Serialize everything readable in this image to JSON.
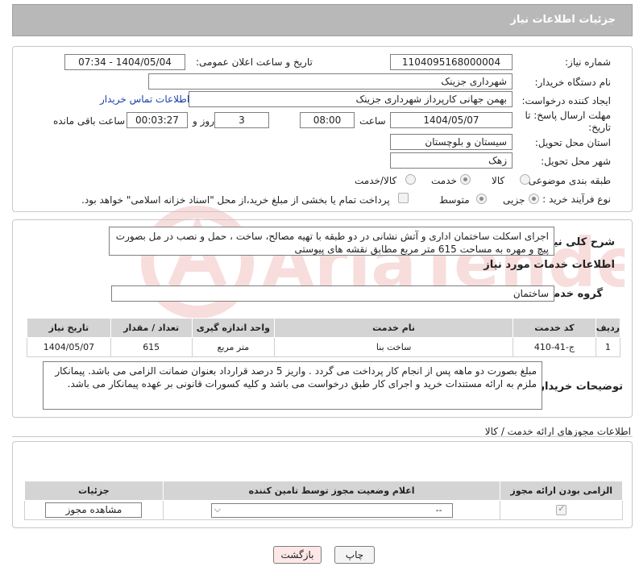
{
  "header": {
    "title": "جزئیات اطلاعات نیاز"
  },
  "form": {
    "need_number_label": "شماره نیاز:",
    "need_number": "1104095168000004",
    "announce_label": "تاریخ و ساعت اعلان عمومی:",
    "announce_value": "1404/05/04 - 07:34",
    "buyer_org_label": "نام دستگاه خریدار:",
    "buyer_org": "شهرداری جزینک",
    "creator_label": "ایجاد کننده درخواست:",
    "creator": "بهمن جهانی کارپرداز شهرداری جزینک",
    "contact_link": "اطلاعات تماس خریدار",
    "deadline_label": "مهلت ارسال پاسخ: تا تاریخ:",
    "deadline_date": "1404/05/07",
    "time_label": "ساعت",
    "deadline_time": "08:00",
    "days_value": "3",
    "days_label": "روز و",
    "remaining_time": "00:03:27",
    "remaining_label": "ساعت باقی مانده",
    "province_label": "استان محل تحویل:",
    "province": "سیستان و بلوچستان",
    "city_label": "شهر محل تحویل:",
    "city": "زهک",
    "category_label": "طبقه بندی موضوعی:",
    "category_options": [
      "کالا",
      "خدمت",
      "کالا/خدمت"
    ],
    "category_selected": "خدمت",
    "process_label": "نوع فرآیند خرید :",
    "process_options": [
      "جزیی",
      "متوسط"
    ],
    "process_selected": "جزیی",
    "payment_note": "پرداخت تمام یا بخشی از مبلغ خرید،از محل \"اسناد خزانه اسلامی\" خواهد بود."
  },
  "description": {
    "label": "شرح کلی نیاز:",
    "text": "اجرای اسکلت ساختمان اداری و آتش نشانی در دو طبقه با تهیه مصالح، ساخت ، حمل و نصب در مل بصورت پیچ و مهره به مساحت 615 متر مربع مطابق نقشه های پیوستی"
  },
  "services": {
    "section_title": "اطلاعات خدمات مورد نیاز",
    "group_label": "گروه خدمت:",
    "group_value": "ساختمان",
    "columns": [
      "ردیف",
      "کد خدمت",
      "نام خدمت",
      "واحد اندازه گیری",
      "تعداد / مقدار",
      "تاریخ نیاز"
    ],
    "rows": [
      {
        "row": "1",
        "code": "ج-41-410",
        "name": "ساخت بنا",
        "unit": "متر مربع",
        "qty": "615",
        "date": "1404/05/07"
      }
    ]
  },
  "buyer_notes": {
    "label": "توضیحات خریدار:",
    "text": "مبلغ بصورت دو ماهه پس از انجام کار پرداخت می گردد . واریز 5 درصد قرارداد بعنوان ضمانت الزامی می باشد. پیمانکار ملزم به ارائه مستندات خرید و اجرای کار طبق درخواست می باشد و کلیه کسورات قانونی بر عهده پیمانکار می باشد."
  },
  "permits": {
    "section_title": "اطلاعات مجوزهای ارائه خدمت / کالا",
    "columns": [
      "الزامی بودن ارائه مجوز",
      "اعلام وضعیت مجوز توسط تامین کننده",
      "جزئیات"
    ],
    "select_value": "--",
    "view_button": "مشاهده مجوز"
  },
  "footer": {
    "print_button": "چاپ",
    "back_button": "بازگشت"
  },
  "colors": {
    "link": "#1a3fa8",
    "header_bg": "#b8b8b8",
    "back_button_bg": "#fde7e7"
  }
}
